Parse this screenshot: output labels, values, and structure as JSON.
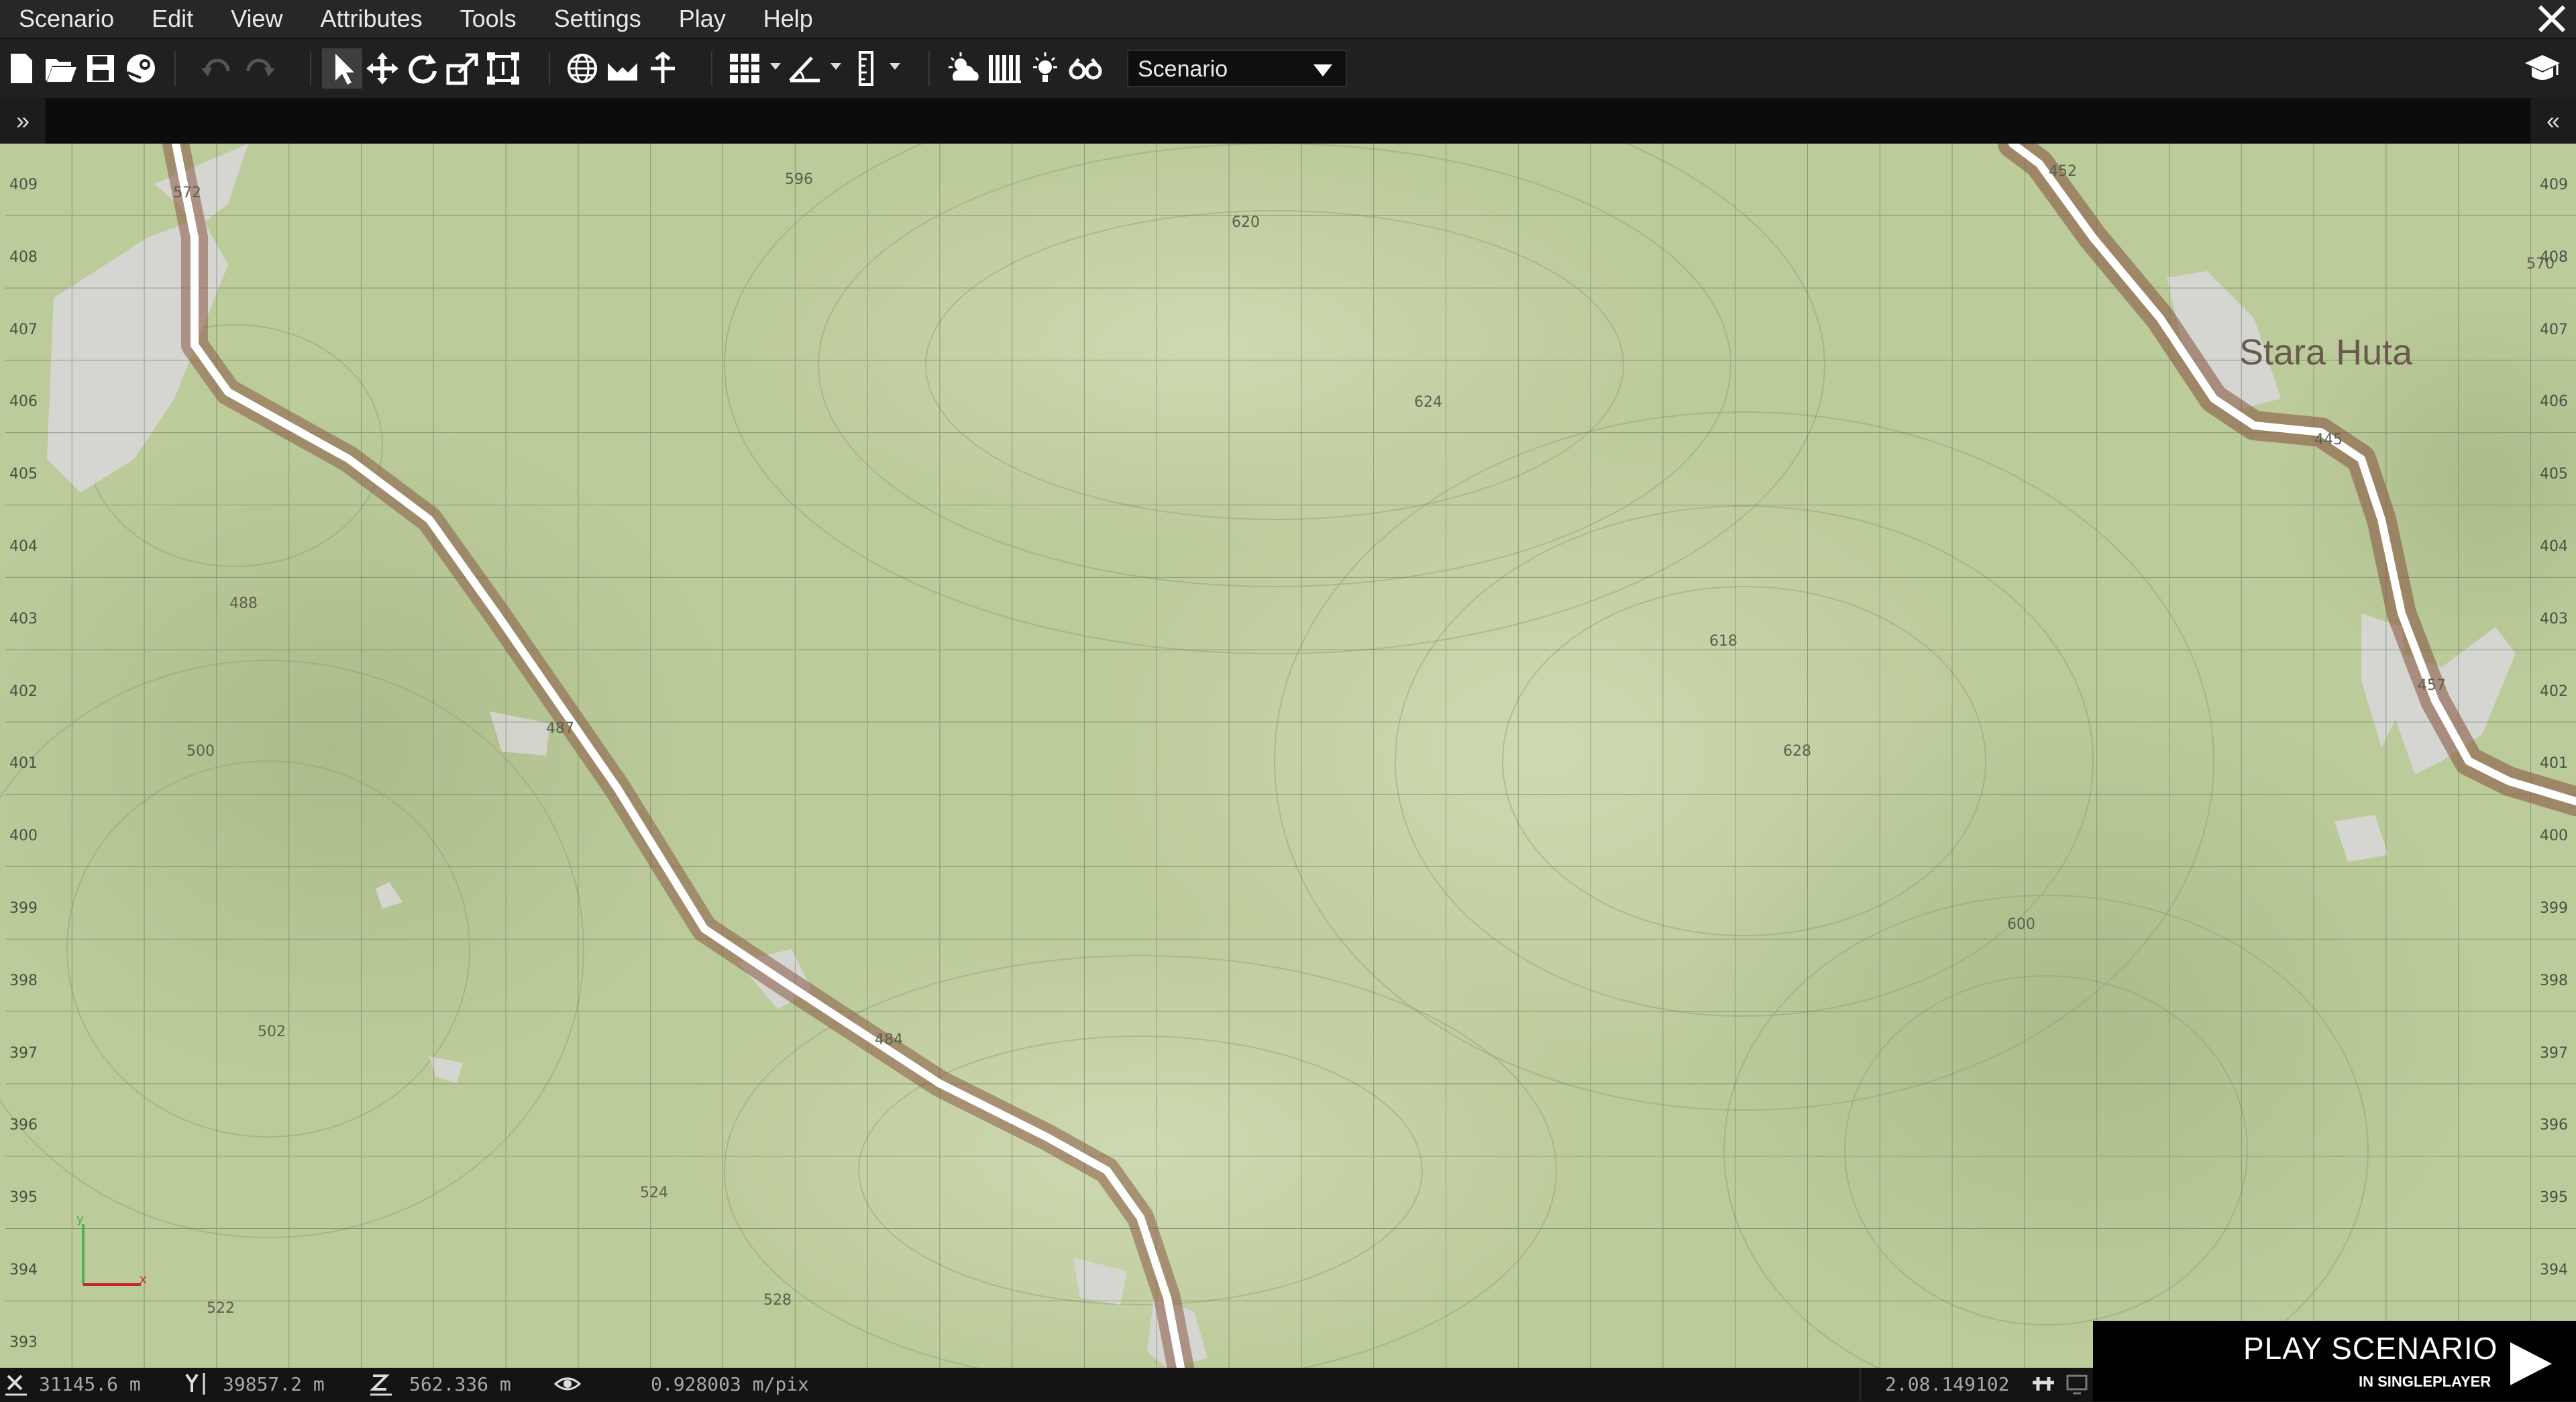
{
  "menu": [
    "Scenario",
    "Edit",
    "View",
    "Attributes",
    "Tools",
    "Settings",
    "Play",
    "Help"
  ],
  "toolbar": {
    "mode_select": "Scenario",
    "icons": [
      "new-file-icon",
      "open-folder-icon",
      "save-icon",
      "steam-icon",
      "undo-icon",
      "redo-icon",
      "select-tool-icon",
      "move-tool-icon",
      "rotate-tool-icon",
      "scale-tool-icon",
      "area-tool-icon",
      "globe-icon",
      "terrain-snap-icon",
      "vertical-icon",
      "grid-icon",
      "angle-icon",
      "ruler-icon",
      "weather-icon",
      "library-icon",
      "lighting-icon",
      "binoculars-icon",
      "graduation-cap-icon"
    ]
  },
  "panels": {
    "left_toggle": "»",
    "right_toggle": "«"
  },
  "map": {
    "town": "Stara Huta",
    "grid_labels_left": [
      "409",
      "408",
      "407",
      "406",
      "405",
      "404",
      "403",
      "402",
      "401",
      "400",
      "399",
      "398",
      "397",
      "396",
      "395",
      "394",
      "393"
    ],
    "grid_labels_right": [
      "409",
      "408",
      "407",
      "406",
      "405",
      "404",
      "403",
      "402",
      "401",
      "400",
      "399",
      "398",
      "397",
      "396",
      "395",
      "394"
    ],
    "elevations": [
      "572",
      "596",
      "620",
      "624",
      "488",
      "487",
      "500",
      "618",
      "628",
      "600",
      "502",
      "484",
      "524",
      "522",
      "528",
      "457",
      "445",
      "452",
      "570"
    ],
    "colors": {
      "terrain": "#bccb9a",
      "grid": "#5d6a52",
      "road": "#ffffff",
      "road_edge": "#8a5a45",
      "urban": "#d5d6d2"
    }
  },
  "play_panel": {
    "title": "PLAY SCENARIO",
    "subtitle": "IN SINGLEPLAYER"
  },
  "status": {
    "x": "31145.6 m",
    "y": "39857.2 m",
    "z": "562.336 m",
    "scale": "0.928003 m/pix",
    "version": "2.08.149102"
  }
}
